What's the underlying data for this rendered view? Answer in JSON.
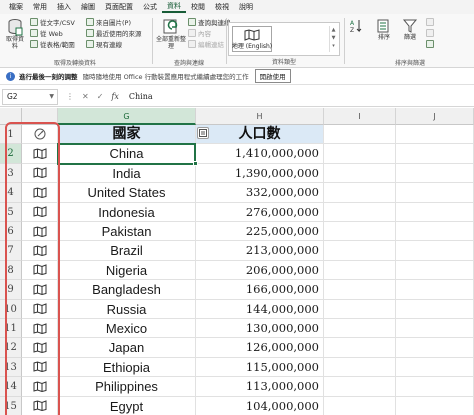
{
  "menu_tabs": [
    "檔案",
    "常用",
    "插入",
    "繪圖",
    "頁面配置",
    "公式",
    "資料",
    "校閱",
    "檢視",
    "說明"
  ],
  "active_tab_index": 6,
  "ribbon": {
    "get_data_label": "取得資料",
    "from_text_csv": "從文字/CSV",
    "from_web": "從 Web",
    "from_table_range": "從表格/範圍",
    "from_picture": "來自圖片(P)",
    "recent_sources": "最近使用的來源",
    "existing_connections": "現有連線",
    "group_get_transform": "取得及轉換資料",
    "refresh_all": "全部重新整理",
    "queries_connections": "查詢與連線",
    "properties": "內容",
    "edit_links": "編輯連結",
    "group_queries": "查詢與連線",
    "data_type_label": "地理 (English)",
    "group_data_types": "資料類型",
    "sort": "排序",
    "filter": "篩選",
    "group_sort_filter": "排序與篩選"
  },
  "infobar": {
    "icon": "i",
    "title": "進行最後一刻的調整",
    "message": "隨時隨地使用 Office 行動裝置應用程式繼續處理您的工作",
    "button": "開啟使用"
  },
  "formula_bar": {
    "name_box": "G2",
    "cancel": "✕",
    "confirm": "✓",
    "fx": "fx",
    "content": "China"
  },
  "columns": {
    "G": "G",
    "H": "H",
    "I": "I",
    "J": "J"
  },
  "header_row": {
    "row_number": "1",
    "country_header": "國家",
    "population_header": "人口數"
  },
  "rows": [
    {
      "row": "2",
      "country": "China",
      "population": "1,410,000,000"
    },
    {
      "row": "3",
      "country": "India",
      "population": "1,390,000,000"
    },
    {
      "row": "4",
      "country": "United States",
      "population": "332,000,000"
    },
    {
      "row": "5",
      "country": "Indonesia",
      "population": "276,000,000"
    },
    {
      "row": "6",
      "country": "Pakistan",
      "population": "225,000,000"
    },
    {
      "row": "7",
      "country": "Brazil",
      "population": "213,000,000"
    },
    {
      "row": "8",
      "country": "Nigeria",
      "population": "206,000,000"
    },
    {
      "row": "9",
      "country": "Bangladesh",
      "population": "166,000,000"
    },
    {
      "row": "10",
      "country": "Russia",
      "population": "144,000,000"
    },
    {
      "row": "11",
      "country": "Mexico",
      "population": "130,000,000"
    },
    {
      "row": "12",
      "country": "Japan",
      "population": "126,000,000"
    },
    {
      "row": "13",
      "country": "Ethiopia",
      "population": "115,000,000"
    },
    {
      "row": "14",
      "country": "Philippines",
      "population": "113,000,000"
    },
    {
      "row": "15",
      "country": "Egypt",
      "population": "104,000,000"
    }
  ],
  "colors": {
    "excel_green": "#217346",
    "highlight_red": "#d9534f",
    "header_fill": "#dbe9f6"
  }
}
